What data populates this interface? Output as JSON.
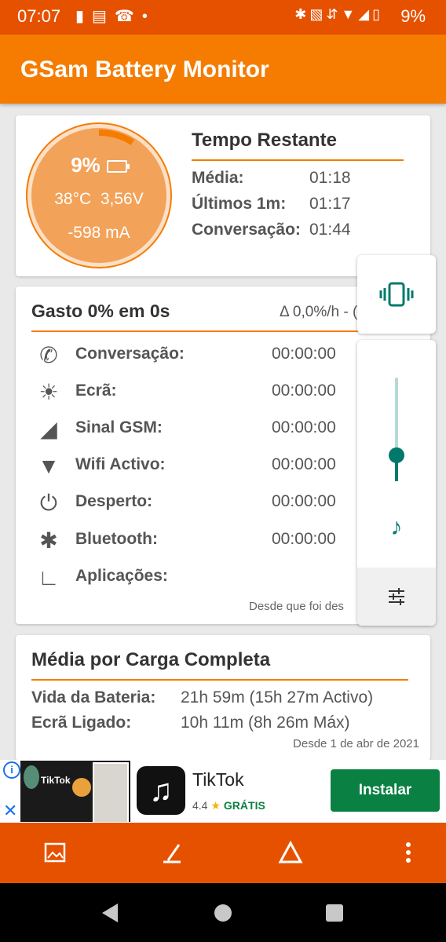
{
  "status_bar": {
    "time": "07:07",
    "left_icons": [
      "alert-icon",
      "message-icon",
      "missed-call-icon",
      "dot-icon"
    ],
    "right_icons": [
      "bluetooth-icon",
      "vibrate-icon",
      "data-arrows-icon",
      "wifi-icon",
      "4g-signal-icon",
      "battery-icon"
    ],
    "battery": "9%"
  },
  "app_bar": {
    "title": "GSam Battery Monitor"
  },
  "battery_card": {
    "percent": "9%",
    "temperature": "38°C",
    "voltage": "3,56V",
    "current": "-598 mA",
    "level_fraction": 0.09,
    "remaining_title": "Tempo Restante",
    "rows": [
      {
        "label": "Média:",
        "value": "01:18"
      },
      {
        "label": "Últimos 1m:",
        "value": "01:17"
      },
      {
        "label": "Conversação:",
        "value": "01:44"
      }
    ]
  },
  "usage_card": {
    "title": "Gasto 0% em 0s",
    "delta": "Δ 0,0%/h - (",
    "rows": [
      {
        "icon": "phone-icon",
        "label": "Conversação:",
        "value": "00:00:00"
      },
      {
        "icon": "brightness-icon",
        "label": "Ecrã:",
        "value": "00:00:00"
      },
      {
        "icon": "signal-bars-icon",
        "label": "Sinal GSM:",
        "value": "00:00:00"
      },
      {
        "icon": "wifi-icon",
        "label": "Wifi Activo:",
        "value": "00:00:00"
      },
      {
        "icon": "power-icon",
        "label": "Desperto:",
        "value": "00:00:00"
      },
      {
        "icon": "bluetooth-icon",
        "label": "Bluetooth:",
        "value": "00:00:00"
      },
      {
        "icon": "gauge-icon",
        "label": "Aplicações:",
        "value": ""
      }
    ],
    "since": "Desde que foi des"
  },
  "full_charge_card": {
    "title": "Média por Carga Completa",
    "rows": [
      {
        "label": "Vida da Bateria:",
        "value": "21h 59m (15h 27m Activo)"
      },
      {
        "label": "Ecrã Ligado:",
        "value": "10h 11m (8h 26m Máx)"
      }
    ],
    "since": "Desde 1 de abr de 2021"
  },
  "volume_panel": {
    "level_fraction": 0.25,
    "icons": [
      "vibrate-icon",
      "music-note-icon",
      "equalizer-settings-icon"
    ]
  },
  "ad": {
    "thumb_brand": "TikTok",
    "app_name": "TikTok",
    "rating": "4.4",
    "price": "GRÁTIS",
    "install_label": "Instalar"
  },
  "bottom_bar": {
    "icons": [
      "image-icon",
      "gauge-icon",
      "triangle-icon",
      "more-vert-icon"
    ]
  },
  "colors": {
    "primary": "#f57c00",
    "status": "#e65100",
    "teal": "#00796b",
    "install": "#0a8043"
  }
}
